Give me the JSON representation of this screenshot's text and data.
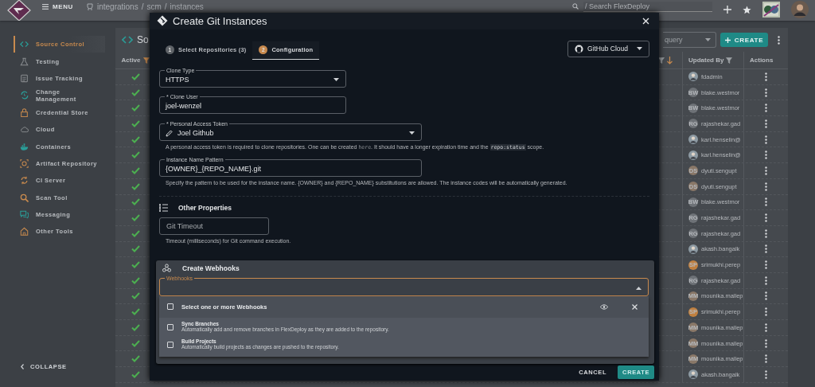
{
  "header": {
    "menu_label": "MENU",
    "breadcrumb": [
      "integrations",
      "/",
      "scm",
      "/",
      "instances"
    ],
    "search": {
      "placeholder": "/ Search FlexDeploy"
    }
  },
  "sidebar": {
    "items": [
      {
        "label": "Source Control",
        "selected": true
      },
      {
        "label": "Testing",
        "selected": false
      },
      {
        "label": "Issue Tracking",
        "selected": false
      },
      {
        "label": "Change Management",
        "selected": false
      },
      {
        "label": "Credential Store",
        "selected": false
      },
      {
        "label": "Cloud",
        "selected": false
      },
      {
        "label": "Containers",
        "selected": false
      },
      {
        "label": "Artifact Repository",
        "selected": false
      },
      {
        "label": "CI Server",
        "selected": false
      },
      {
        "label": "Scan Tool",
        "selected": false
      },
      {
        "label": "Messaging",
        "selected": false
      },
      {
        "label": "Other Tools",
        "selected": false
      }
    ],
    "collapse_label": "COLLAPSE"
  },
  "page": {
    "title": "So",
    "query": {
      "placeholder": "query"
    },
    "create_button": "CREATE",
    "columns": [
      {
        "label": "Active"
      },
      {
        "label": "Updated By"
      },
      {
        "label": "Actions"
      }
    ],
    "rows": [
      {
        "active": true,
        "updated_by": "fdadmin"
      },
      {
        "active": true,
        "updated_by": "blake.westmor",
        "avatar": {
          "kind": "initials",
          "initials": "BW",
          "color": "#6e7277"
        }
      },
      {
        "active": true,
        "updated_by": "blake.westmor",
        "avatar": {
          "kind": "initials",
          "initials": "BW",
          "color": "#6e7277"
        }
      },
      {
        "active": true,
        "updated_by": "rajashekar.gad",
        "avatar": {
          "kind": "initials",
          "initials": "RG",
          "color": "#6e7277"
        }
      },
      {
        "active": true,
        "updated_by": "karl.henselin@"
      },
      {
        "active": true,
        "updated_by": "karl.henselin@"
      },
      {
        "active": true,
        "updated_by": "dyuti.sengupt",
        "avatar": {
          "kind": "initials",
          "initials": "DS",
          "color": "#8a7868"
        }
      },
      {
        "active": true,
        "updated_by": "dyuti.sengupt",
        "avatar": {
          "kind": "initials",
          "initials": "DS",
          "color": "#8a7868"
        }
      },
      {
        "active": true,
        "updated_by": "blake.westmor",
        "avatar": {
          "kind": "initials",
          "initials": "BW",
          "color": "#6e7277"
        }
      },
      {
        "active": true,
        "updated_by": "rajashekar.gad",
        "avatar": {
          "kind": "initials",
          "initials": "RG",
          "color": "#6e7277"
        }
      },
      {
        "active": true,
        "updated_by": "rajashekar.gad",
        "avatar": {
          "kind": "initials",
          "initials": "RG",
          "color": "#6e7277"
        }
      },
      {
        "active": true,
        "updated_by": "akash.bangalk"
      },
      {
        "active": true,
        "updated_by": "srimukhi.perep",
        "avatar": {
          "kind": "initials",
          "initials": "SP",
          "color": "#c08040"
        }
      },
      {
        "active": true,
        "updated_by": "rajashekar.gad",
        "avatar": {
          "kind": "initials",
          "initials": "RG",
          "color": "#6e7277"
        }
      },
      {
        "active": true,
        "updated_by": "mounika.mallep",
        "avatar": {
          "kind": "initials",
          "initials": "MM",
          "color": "#8a7868"
        }
      },
      {
        "active": true,
        "updated_by": "srimukhi.perep",
        "avatar": {
          "kind": "initials",
          "initials": "SP",
          "color": "#c08040"
        }
      },
      {
        "active": true,
        "updated_by": "mounika.mallep",
        "avatar": {
          "kind": "initials",
          "initials": "MM",
          "color": "#8a7868"
        }
      },
      {
        "active": true,
        "updated_by": "mounika.mallep",
        "avatar": {
          "kind": "initials",
          "initials": "MM",
          "color": "#8a7868"
        }
      },
      {
        "active": true,
        "updated_by": "mounika.mallep",
        "avatar": {
          "kind": "initials",
          "initials": "MM",
          "color": "#8a7868"
        }
      },
      {
        "active": true,
        "updated_by": "akash.bangalk"
      }
    ]
  },
  "dialog": {
    "title": "Create Git Instances",
    "steps": [
      {
        "number": "1",
        "label": "Select Repositories (3)",
        "selected": false
      },
      {
        "number": "2",
        "label": "Configuration",
        "selected": true
      }
    ],
    "provider": {
      "value": "GitHub Cloud"
    },
    "fields": [
      {
        "kind": "select",
        "label": "Clone Type",
        "value": "HTTPS"
      },
      {
        "kind": "text",
        "label": "* Clone User",
        "value": "joel-wenzel"
      },
      {
        "kind": "credential",
        "label": "* Personal Access Token",
        "value": "Joel Github",
        "help": [
          {
            "kind": "text",
            "text": "A personal access token is required to clone repositories. One can be created "
          },
          {
            "kind": "link",
            "text": "here"
          },
          {
            "kind": "text",
            "text": ". It should have a longer expiration time and the "
          },
          {
            "kind": "code",
            "text": "repo:status"
          },
          {
            "kind": "text",
            "text": " scope."
          }
        ]
      },
      {
        "kind": "text",
        "label": "Instance Name Pattern",
        "value": "{OWNER}_{REPO_NAME}.git",
        "help": [
          {
            "kind": "text",
            "text": "Specify the pattern to be used for the instance name. {OWNER} and {REPO_NAME} substitutions are allowed. The instance codes will be automatically generated."
          }
        ]
      }
    ],
    "other_properties": {
      "title": "Other Properties",
      "fields": [
        {
          "kind": "text",
          "placeholder": "Git Timeout",
          "help": [
            {
              "kind": "text",
              "text": "Timeout (milliseconds) for Git command execution."
            }
          ]
        }
      ]
    },
    "webhooks": {
      "title": "Create Webhooks",
      "field": {
        "label": "Webhooks",
        "expanded": true
      },
      "select_all": {
        "label": "Select one or more Webhooks",
        "checked": false
      },
      "options": [
        {
          "label": "Sync Branches",
          "description": "Automatically add and remove branches in FlexDeploy as they are added to the repository.",
          "checked": false
        },
        {
          "label": "Build Projects",
          "description": "Automatically build projects as changes are pushed to the repository.",
          "checked": false
        }
      ]
    },
    "buttons": [
      {
        "kind": "text",
        "label": "CANCEL"
      },
      {
        "kind": "primary",
        "label": "CREATE"
      }
    ]
  }
}
